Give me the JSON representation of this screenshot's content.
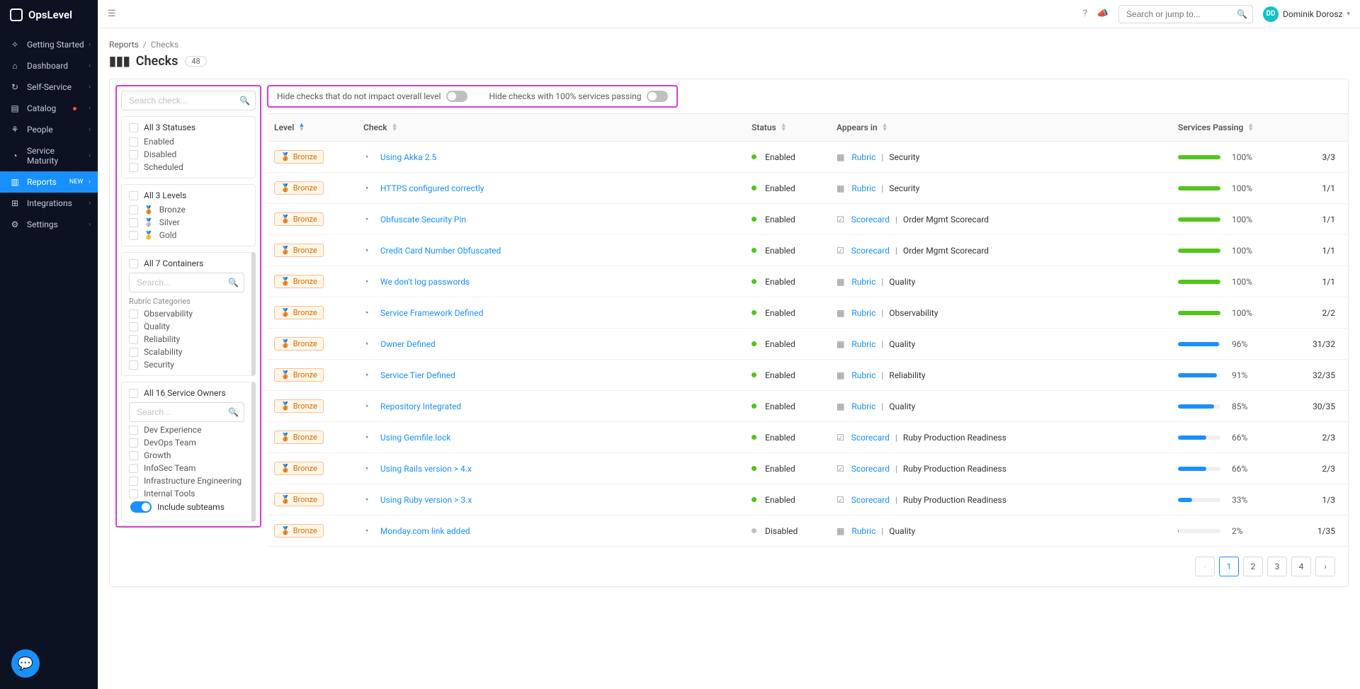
{
  "app": {
    "name": "OpsLevel"
  },
  "topbar": {
    "search_placeholder": "Search or jump to...",
    "user_initials": "DD",
    "user_name": "Dominik Dorosz"
  },
  "nav": {
    "items": [
      {
        "label": "Getting Started",
        "icon": "✧"
      },
      {
        "label": "Dashboard",
        "icon": "⌂"
      },
      {
        "label": "Self-Service",
        "icon": "↻"
      },
      {
        "label": "Catalog",
        "icon": "▤",
        "dot": true
      },
      {
        "label": "People",
        "icon": "⚘"
      },
      {
        "label": "Service Maturity",
        "icon": "◔"
      },
      {
        "label": "Reports",
        "icon": "▥",
        "badge": "NEW",
        "active": true
      },
      {
        "label": "Integrations",
        "icon": "⊞"
      },
      {
        "label": "Settings",
        "icon": "⚙"
      }
    ]
  },
  "breadcrumb": {
    "parent": "Reports",
    "current": "Checks"
  },
  "page": {
    "title": "Checks",
    "count": "48",
    "icon": "📊"
  },
  "toggles": {
    "hide_no_impact": "Hide checks that do not impact overall level",
    "hide_100": "Hide checks with 100% services passing"
  },
  "filters": {
    "search_placeholder": "Search check...",
    "status": {
      "head": "All 3 Statuses",
      "opts": [
        "Enabled",
        "Disabled",
        "Scheduled"
      ]
    },
    "levels": {
      "head": "All 3 Levels",
      "opts": [
        {
          "label": "Bronze",
          "medal": "🥉"
        },
        {
          "label": "Silver",
          "medal": "🥈"
        },
        {
          "label": "Gold",
          "medal": "🥇"
        }
      ]
    },
    "containers": {
      "head": "All 7 Containers",
      "search_placeholder": "Search...",
      "subhead": "Rubric Categories",
      "opts": [
        "Observability",
        "Quality",
        "Reliability",
        "Scalability",
        "Security"
      ]
    },
    "owners": {
      "head": "All 16 Service Owners",
      "search_placeholder": "Search...",
      "opts": [
        "Dev Experience",
        "DevOps Team",
        "Growth",
        "InfoSec Team",
        "Infrastructure Engineering",
        "Internal Tools"
      ]
    },
    "include_subteams": "Include subteams"
  },
  "columns": {
    "level": "Level",
    "check": "Check",
    "status": "Status",
    "appears": "Appears in",
    "passing": "Services Passing"
  },
  "rows": [
    {
      "level": "Bronze",
      "check": "Using Akka 2.5",
      "status": "Enabled",
      "appears_type": "Rubric",
      "appears_cat": "Security",
      "pct": 100,
      "ratio": "3/3",
      "color": "green"
    },
    {
      "level": "Bronze",
      "check": "HTTPS configured correctly",
      "status": "Enabled",
      "appears_type": "Rubric",
      "appears_cat": "Security",
      "pct": 100,
      "ratio": "1/1",
      "color": "green"
    },
    {
      "level": "Bronze",
      "check": "Obfuscate Security Pin",
      "status": "Enabled",
      "appears_type": "Scorecard",
      "appears_cat": "Order Mgmt Scorecard",
      "pct": 100,
      "ratio": "1/1",
      "color": "green"
    },
    {
      "level": "Bronze",
      "check": "Credit Card Number Obfuscated",
      "status": "Enabled",
      "appears_type": "Scorecard",
      "appears_cat": "Order Mgmt Scorecard",
      "pct": 100,
      "ratio": "1/1",
      "color": "green"
    },
    {
      "level": "Bronze",
      "check": "We don't log passwords",
      "status": "Enabled",
      "appears_type": "Rubric",
      "appears_cat": "Quality",
      "pct": 100,
      "ratio": "1/1",
      "color": "green"
    },
    {
      "level": "Bronze",
      "check": "Service Framework Defined",
      "status": "Enabled",
      "appears_type": "Rubric",
      "appears_cat": "Observability",
      "pct": 100,
      "ratio": "2/2",
      "color": "green"
    },
    {
      "level": "Bronze",
      "check": "Owner Defined",
      "status": "Enabled",
      "appears_type": "Rubric",
      "appears_cat": "Quality",
      "pct": 96,
      "ratio": "31/32",
      "color": "blue"
    },
    {
      "level": "Bronze",
      "check": "Service Tier Defined",
      "status": "Enabled",
      "appears_type": "Rubric",
      "appears_cat": "Reliability",
      "pct": 91,
      "ratio": "32/35",
      "color": "blue"
    },
    {
      "level": "Bronze",
      "check": "Repository Integrated",
      "status": "Enabled",
      "appears_type": "Rubric",
      "appears_cat": "Quality",
      "pct": 85,
      "ratio": "30/35",
      "color": "blue"
    },
    {
      "level": "Bronze",
      "check": "Using Gemfile.lock",
      "status": "Enabled",
      "appears_type": "Scorecard",
      "appears_cat": "Ruby Production Readiness",
      "pct": 66,
      "ratio": "2/3",
      "color": "blue"
    },
    {
      "level": "Bronze",
      "check": "Using Rails version > 4.x",
      "status": "Enabled",
      "appears_type": "Scorecard",
      "appears_cat": "Ruby Production Readiness",
      "pct": 66,
      "ratio": "2/3",
      "color": "blue"
    },
    {
      "level": "Bronze",
      "check": "Using Ruby version > 3.x",
      "status": "Enabled",
      "appears_type": "Scorecard",
      "appears_cat": "Ruby Production Readiness",
      "pct": 33,
      "ratio": "1/3",
      "color": "blue"
    },
    {
      "level": "Bronze",
      "check": "Monday.com link added",
      "status": "Disabled",
      "appears_type": "Rubric",
      "appears_cat": "Quality",
      "pct": 2,
      "ratio": "1/35",
      "color": "blue"
    }
  ],
  "pagination": {
    "pages": [
      "1",
      "2",
      "3",
      "4"
    ],
    "active": "1"
  }
}
